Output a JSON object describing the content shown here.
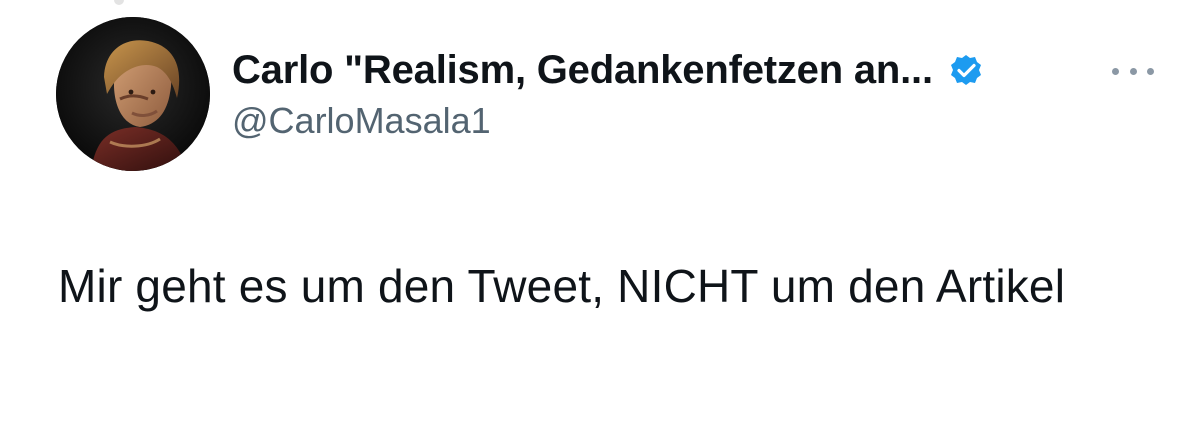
{
  "tweet": {
    "author": {
      "display_name": "Carlo \"Realism, Gedankenfetzen an...",
      "handle": "@CarloMasala1",
      "verified": true,
      "verified_color": "#1d9bf0",
      "avatar_icon": "profile-photo"
    },
    "more_icon": "more-options-icon",
    "text": "Mir geht es um den Tweet, NICHT um den Artikel"
  }
}
